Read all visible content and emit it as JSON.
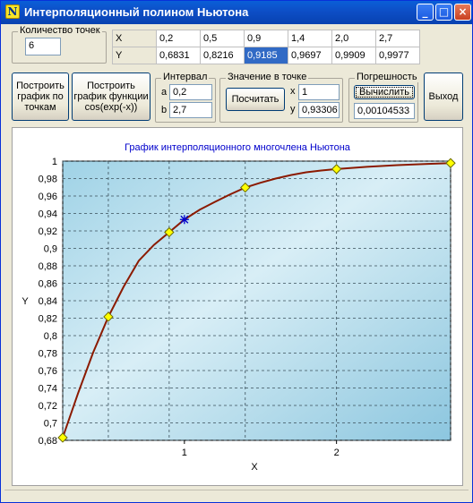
{
  "window": {
    "title": "Интерполяционный полином Ньютона",
    "icon_glyph": "N"
  },
  "titlebar_buttons": {
    "minimize": "_",
    "maximize": "□",
    "close": "×"
  },
  "points_count": {
    "label": "Количество точек",
    "value": "6"
  },
  "table": {
    "x_header": "X",
    "y_header": "Y",
    "x_values": [
      "0,2",
      "0,5",
      "0,9",
      "1,4",
      "2,0",
      "2,7"
    ],
    "y_values": [
      "0,6831",
      "0,8216",
      "0,9185",
      "0,9697",
      "0,9909",
      "0,9977"
    ],
    "selected": {
      "row": "y",
      "index": 2
    }
  },
  "buttons": {
    "plot_points": "Построить график по точкам",
    "plot_function": "Построить график функции cos(exp(-x))",
    "calculate": "Посчитать",
    "compute_error": "Вычислить",
    "exit": "Выход"
  },
  "interval": {
    "label": "Интервал",
    "a_label": "a",
    "a_value": "0,2",
    "b_label": "b",
    "b_value": "2,7"
  },
  "point_value": {
    "label": "Значение в точке",
    "x_label": "x",
    "x_value": "1",
    "y_label": "y",
    "y_value": "0,93306"
  },
  "error": {
    "label": "Погрешность",
    "value": "0,00104533"
  },
  "chart_data": {
    "type": "line",
    "title": "График интерполяционного многочлена Ньютона",
    "xlabel": "X",
    "ylabel": "Y",
    "xlim": [
      0.2,
      2.75
    ],
    "ylim": [
      0.68,
      1.0
    ],
    "x_ticks": [
      "1",
      "2"
    ],
    "y_ticks": [
      "0,68",
      "0,7",
      "0,72",
      "0,74",
      "0,76",
      "0,78",
      "0,8",
      "0,82",
      "0,84",
      "0,86",
      "0,88",
      "0,9",
      "0,92",
      "0,94",
      "0,96",
      "0,98",
      "1"
    ],
    "grid": true,
    "series": [
      {
        "kind": "line",
        "color": "#8b1a00",
        "x": [
          0.2,
          0.3,
          0.4,
          0.5,
          0.6,
          0.7,
          0.8,
          0.9,
          1.0,
          1.1,
          1.2,
          1.3,
          1.4,
          1.5,
          1.6,
          1.7,
          1.8,
          1.9,
          2.0,
          2.2,
          2.4,
          2.6,
          2.75
        ],
        "y": [
          0.6831,
          0.7335,
          0.7806,
          0.8216,
          0.8559,
          0.8858,
          0.904,
          0.9185,
          0.9331,
          0.9442,
          0.9532,
          0.9618,
          0.9697,
          0.9752,
          0.98,
          0.984,
          0.9872,
          0.9892,
          0.9909,
          0.9935,
          0.9954,
          0.9968,
          0.9977
        ]
      },
      {
        "kind": "markers",
        "color": "#ffff00",
        "x": [
          0.2,
          0.5,
          0.9,
          1.4,
          2.0,
          2.75
        ],
        "y": [
          0.6831,
          0.8216,
          0.9185,
          0.9697,
          0.9909,
          0.9977
        ]
      },
      {
        "kind": "point",
        "color": "#0000cc",
        "x": [
          1.0
        ],
        "y": [
          0.93306
        ]
      }
    ],
    "colors": {
      "plot_bg": "#a8d8e8",
      "title": "#0000cc"
    }
  }
}
